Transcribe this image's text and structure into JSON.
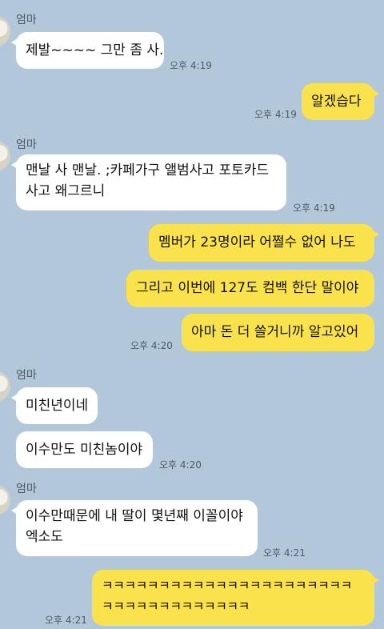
{
  "messages": [
    {
      "sender": "엄마",
      "text": "제발~~~~ 그만 좀 사.",
      "time": "오후 4:19"
    },
    {
      "sender": "me",
      "text": "알겠습다",
      "time": "오후 4:19"
    },
    {
      "sender": "엄마",
      "line1": "맨날 사 맨날. ;카페가구 앨범사고 포토카드",
      "line2": "사고 왜그르니",
      "time": "오후 4:19"
    },
    {
      "sender": "me",
      "text": "멤버가 23명이라 어쩔수 없어 나도"
    },
    {
      "sender": "me",
      "text": "그리고 이번에 127도 컴백 한단 말이야"
    },
    {
      "sender": "me",
      "text": "아마 돈 더 쓸거니까 알고있어",
      "time": "오후 4:20"
    },
    {
      "sender": "엄마",
      "text": "미친년이네"
    },
    {
      "sender": "엄마",
      "text": "이수만도 미친놈이야",
      "time": "오후 4:20"
    },
    {
      "sender": "엄마",
      "line1": "이수만때문에 내 딸이 몇년째 이꼴이야",
      "line2": "엑소도",
      "time": "오후 4:21"
    },
    {
      "sender": "me",
      "line1": "ㅋㅋㅋㅋㅋㅋㅋㅋㅋㅋㅋㅋㅋㅋㅋㅋㅋㅋㅋㅋㅋㅋ",
      "line2": "ㅋㅋㅋㅋㅋㅋㅋㅋㅋㅋㅋㅋㅋ",
      "time": "오후 4:21"
    }
  ],
  "colors": {
    "background": "#b2c7d9",
    "sent_bubble": "#fae24c",
    "received_bubble": "#ffffff"
  }
}
